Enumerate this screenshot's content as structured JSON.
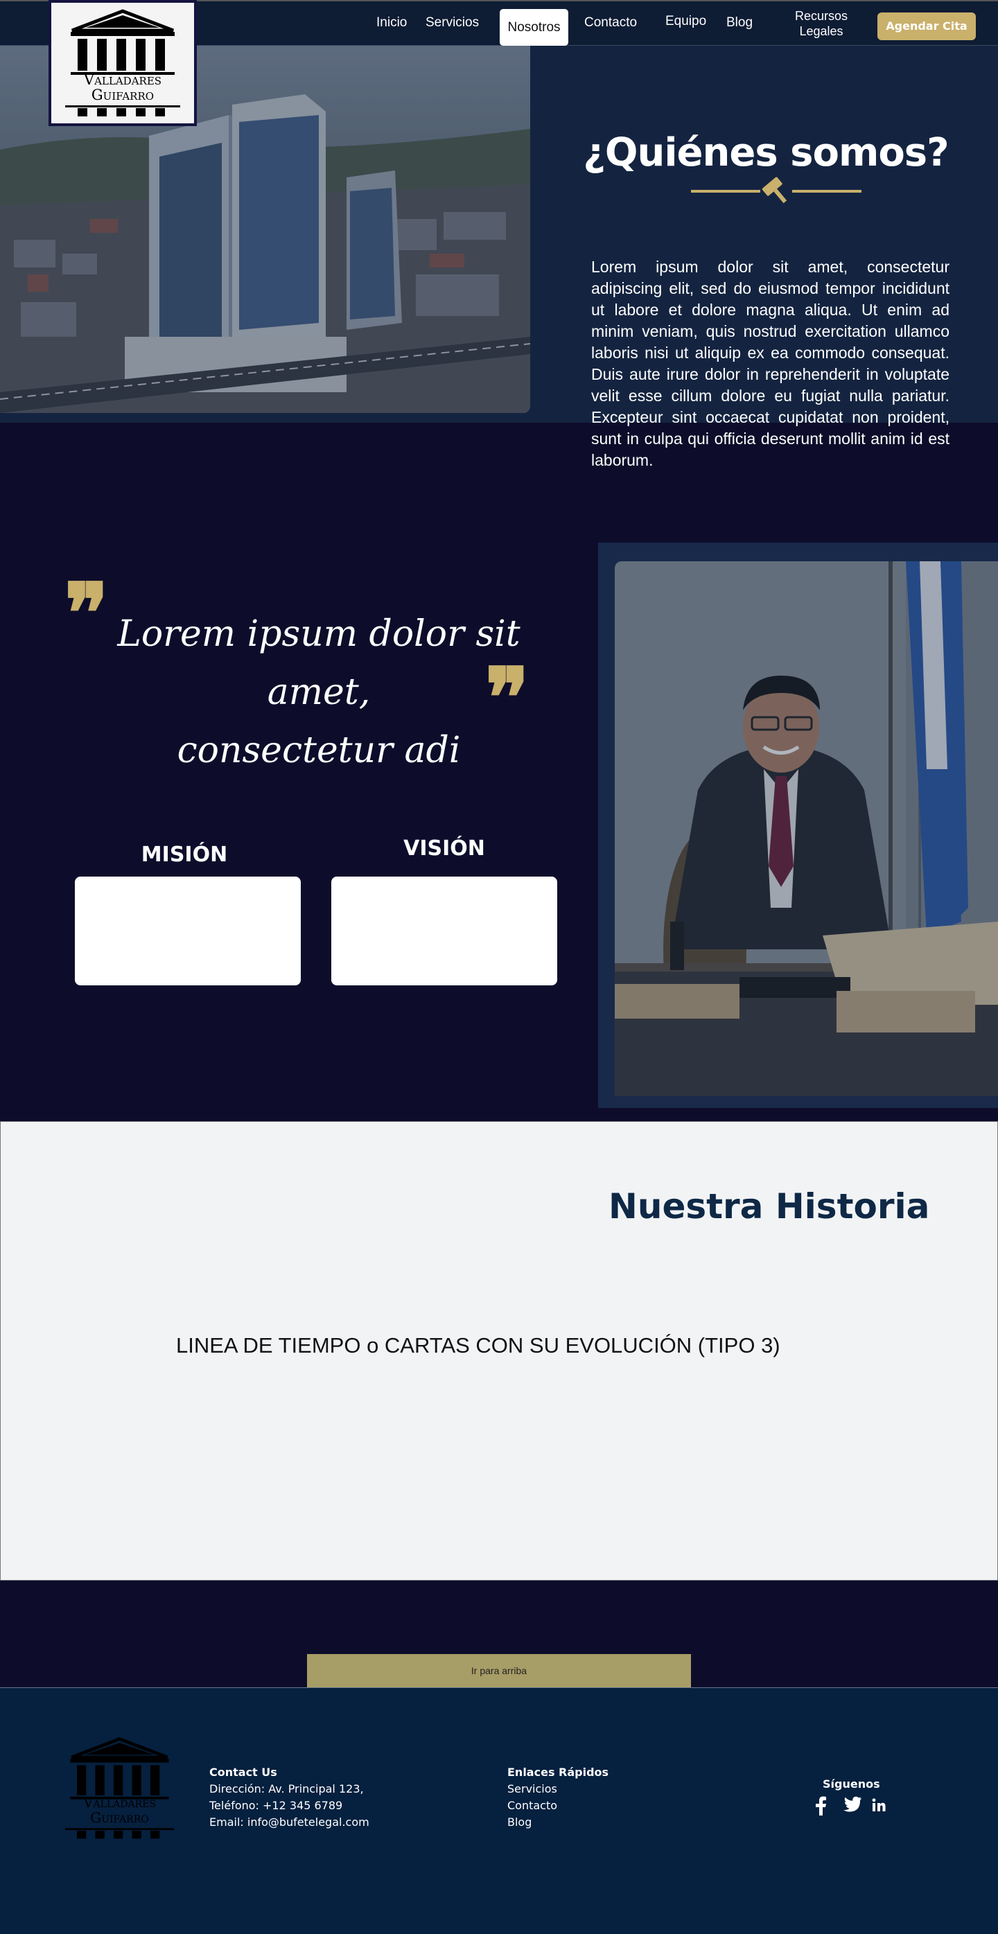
{
  "brand": {
    "name_line1": "Valladares",
    "name_line2": "Guifarro"
  },
  "nav": {
    "items": [
      "Inicio",
      "Servicios",
      "Nosotros",
      "Contacto",
      "Equipo",
      "Blog"
    ],
    "recursos_line1": "Recursos",
    "recursos_line2": "Legales",
    "cta_label": "Agendar Cita"
  },
  "hero": {
    "title": "¿Quiénes somos?",
    "body": "Lorem ipsum dolor sit amet, consectetur adipiscing elit, sed do eiusmod tempor incididunt ut labore et dolore magna aliqua. Ut enim ad minim veniam, quis nostrud exercitation ullamco laboris nisi ut aliquip ex ea commodo consequat. Duis aute irure dolor in reprehenderit in voluptate velit esse cillum dolore eu fugiat nulla pariatur. Excepteur sint occaecat cupidatat non proident, sunt in culpa qui officia deserunt mollit anim id est laborum."
  },
  "quote": {
    "line1": "Lorem ipsum dolor sit amet,",
    "line2": "consectetur adi"
  },
  "mision": {
    "title": "MISIÓN"
  },
  "vision": {
    "title": "VISIÓN"
  },
  "historia": {
    "title": "Nuestra Historia",
    "placeholder": "LINEA DE TIEMPO o CARTAS CON SU EVOLUCIÓN (TIPO 3)"
  },
  "back_to_top": "Ir para arriba",
  "footer": {
    "contact_title": "Contact Us",
    "contact_lines": [
      "Dirección: Av. Principal 123,",
      "Teléfono: +12 345 6789",
      "Email: info@bufetelegal.com"
    ],
    "links_title": "Enlaces Rápidos",
    "links": [
      "Servicios",
      "Contacto",
      "Blog"
    ],
    "social_title": "Síguenos",
    "social_icons": [
      "facebook-icon",
      "twitter-icon",
      "linkedin-icon"
    ]
  },
  "colors": {
    "accent_gold": "#c9b06b",
    "navy": "#0e1c34",
    "page_bg": "#0d0d2b",
    "footer_bg": "#06203f",
    "historia_title": "#0e2846"
  }
}
